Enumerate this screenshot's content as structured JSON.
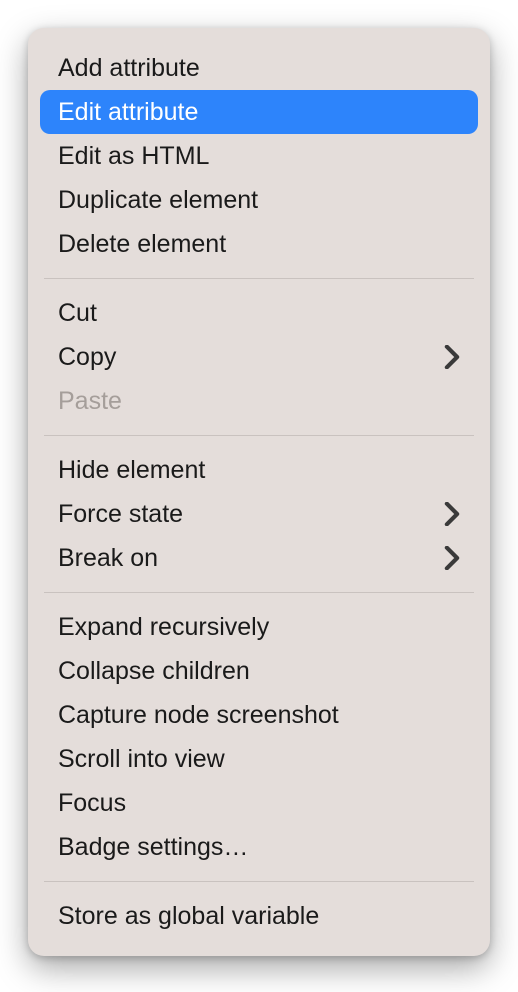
{
  "menu": {
    "groups": [
      {
        "items": [
          {
            "label": "Add attribute",
            "highlighted": false,
            "disabled": false,
            "submenu": false
          },
          {
            "label": "Edit attribute",
            "highlighted": true,
            "disabled": false,
            "submenu": false
          },
          {
            "label": "Edit as HTML",
            "highlighted": false,
            "disabled": false,
            "submenu": false
          },
          {
            "label": "Duplicate element",
            "highlighted": false,
            "disabled": false,
            "submenu": false
          },
          {
            "label": "Delete element",
            "highlighted": false,
            "disabled": false,
            "submenu": false
          }
        ]
      },
      {
        "items": [
          {
            "label": "Cut",
            "highlighted": false,
            "disabled": false,
            "submenu": false
          },
          {
            "label": "Copy",
            "highlighted": false,
            "disabled": false,
            "submenu": true
          },
          {
            "label": "Paste",
            "highlighted": false,
            "disabled": true,
            "submenu": false
          }
        ]
      },
      {
        "items": [
          {
            "label": "Hide element",
            "highlighted": false,
            "disabled": false,
            "submenu": false
          },
          {
            "label": "Force state",
            "highlighted": false,
            "disabled": false,
            "submenu": true
          },
          {
            "label": "Break on",
            "highlighted": false,
            "disabled": false,
            "submenu": true
          }
        ]
      },
      {
        "items": [
          {
            "label": "Expand recursively",
            "highlighted": false,
            "disabled": false,
            "submenu": false
          },
          {
            "label": "Collapse children",
            "highlighted": false,
            "disabled": false,
            "submenu": false
          },
          {
            "label": "Capture node screenshot",
            "highlighted": false,
            "disabled": false,
            "submenu": false
          },
          {
            "label": "Scroll into view",
            "highlighted": false,
            "disabled": false,
            "submenu": false
          },
          {
            "label": "Focus",
            "highlighted": false,
            "disabled": false,
            "submenu": false
          },
          {
            "label": "Badge settings…",
            "highlighted": false,
            "disabled": false,
            "submenu": false
          }
        ]
      },
      {
        "items": [
          {
            "label": "Store as global variable",
            "highlighted": false,
            "disabled": false,
            "submenu": false
          }
        ]
      }
    ]
  }
}
